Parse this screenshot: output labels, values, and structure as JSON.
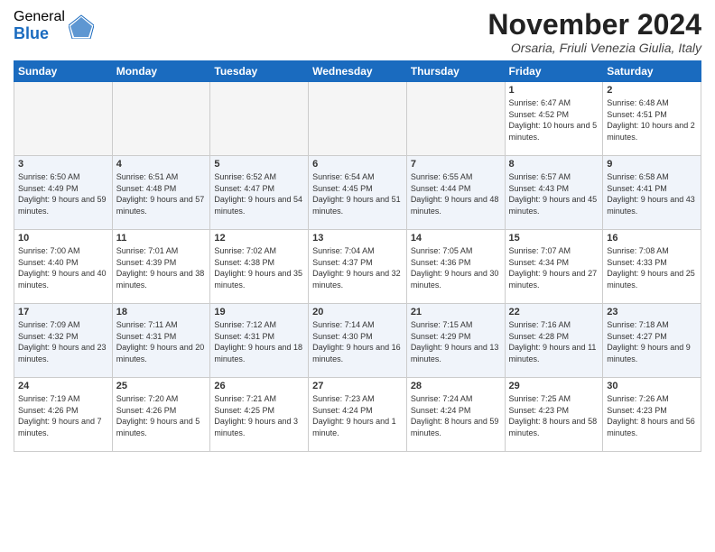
{
  "logo": {
    "general": "General",
    "blue": "Blue"
  },
  "title": "November 2024",
  "subtitle": "Orsaria, Friuli Venezia Giulia, Italy",
  "headers": [
    "Sunday",
    "Monday",
    "Tuesday",
    "Wednesday",
    "Thursday",
    "Friday",
    "Saturday"
  ],
  "weeks": [
    [
      {
        "day": "",
        "info": ""
      },
      {
        "day": "",
        "info": ""
      },
      {
        "day": "",
        "info": ""
      },
      {
        "day": "",
        "info": ""
      },
      {
        "day": "",
        "info": ""
      },
      {
        "day": "1",
        "info": "Sunrise: 6:47 AM\nSunset: 4:52 PM\nDaylight: 10 hours and 5 minutes."
      },
      {
        "day": "2",
        "info": "Sunrise: 6:48 AM\nSunset: 4:51 PM\nDaylight: 10 hours and 2 minutes."
      }
    ],
    [
      {
        "day": "3",
        "info": "Sunrise: 6:50 AM\nSunset: 4:49 PM\nDaylight: 9 hours and 59 minutes."
      },
      {
        "day": "4",
        "info": "Sunrise: 6:51 AM\nSunset: 4:48 PM\nDaylight: 9 hours and 57 minutes."
      },
      {
        "day": "5",
        "info": "Sunrise: 6:52 AM\nSunset: 4:47 PM\nDaylight: 9 hours and 54 minutes."
      },
      {
        "day": "6",
        "info": "Sunrise: 6:54 AM\nSunset: 4:45 PM\nDaylight: 9 hours and 51 minutes."
      },
      {
        "day": "7",
        "info": "Sunrise: 6:55 AM\nSunset: 4:44 PM\nDaylight: 9 hours and 48 minutes."
      },
      {
        "day": "8",
        "info": "Sunrise: 6:57 AM\nSunset: 4:43 PM\nDaylight: 9 hours and 45 minutes."
      },
      {
        "day": "9",
        "info": "Sunrise: 6:58 AM\nSunset: 4:41 PM\nDaylight: 9 hours and 43 minutes."
      }
    ],
    [
      {
        "day": "10",
        "info": "Sunrise: 7:00 AM\nSunset: 4:40 PM\nDaylight: 9 hours and 40 minutes."
      },
      {
        "day": "11",
        "info": "Sunrise: 7:01 AM\nSunset: 4:39 PM\nDaylight: 9 hours and 38 minutes."
      },
      {
        "day": "12",
        "info": "Sunrise: 7:02 AM\nSunset: 4:38 PM\nDaylight: 9 hours and 35 minutes."
      },
      {
        "day": "13",
        "info": "Sunrise: 7:04 AM\nSunset: 4:37 PM\nDaylight: 9 hours and 32 minutes."
      },
      {
        "day": "14",
        "info": "Sunrise: 7:05 AM\nSunset: 4:36 PM\nDaylight: 9 hours and 30 minutes."
      },
      {
        "day": "15",
        "info": "Sunrise: 7:07 AM\nSunset: 4:34 PM\nDaylight: 9 hours and 27 minutes."
      },
      {
        "day": "16",
        "info": "Sunrise: 7:08 AM\nSunset: 4:33 PM\nDaylight: 9 hours and 25 minutes."
      }
    ],
    [
      {
        "day": "17",
        "info": "Sunrise: 7:09 AM\nSunset: 4:32 PM\nDaylight: 9 hours and 23 minutes."
      },
      {
        "day": "18",
        "info": "Sunrise: 7:11 AM\nSunset: 4:31 PM\nDaylight: 9 hours and 20 minutes."
      },
      {
        "day": "19",
        "info": "Sunrise: 7:12 AM\nSunset: 4:31 PM\nDaylight: 9 hours and 18 minutes."
      },
      {
        "day": "20",
        "info": "Sunrise: 7:14 AM\nSunset: 4:30 PM\nDaylight: 9 hours and 16 minutes."
      },
      {
        "day": "21",
        "info": "Sunrise: 7:15 AM\nSunset: 4:29 PM\nDaylight: 9 hours and 13 minutes."
      },
      {
        "day": "22",
        "info": "Sunrise: 7:16 AM\nSunset: 4:28 PM\nDaylight: 9 hours and 11 minutes."
      },
      {
        "day": "23",
        "info": "Sunrise: 7:18 AM\nSunset: 4:27 PM\nDaylight: 9 hours and 9 minutes."
      }
    ],
    [
      {
        "day": "24",
        "info": "Sunrise: 7:19 AM\nSunset: 4:26 PM\nDaylight: 9 hours and 7 minutes."
      },
      {
        "day": "25",
        "info": "Sunrise: 7:20 AM\nSunset: 4:26 PM\nDaylight: 9 hours and 5 minutes."
      },
      {
        "day": "26",
        "info": "Sunrise: 7:21 AM\nSunset: 4:25 PM\nDaylight: 9 hours and 3 minutes."
      },
      {
        "day": "27",
        "info": "Sunrise: 7:23 AM\nSunset: 4:24 PM\nDaylight: 9 hours and 1 minute."
      },
      {
        "day": "28",
        "info": "Sunrise: 7:24 AM\nSunset: 4:24 PM\nDaylight: 8 hours and 59 minutes."
      },
      {
        "day": "29",
        "info": "Sunrise: 7:25 AM\nSunset: 4:23 PM\nDaylight: 8 hours and 58 minutes."
      },
      {
        "day": "30",
        "info": "Sunrise: 7:26 AM\nSunset: 4:23 PM\nDaylight: 8 hours and 56 minutes."
      }
    ]
  ]
}
